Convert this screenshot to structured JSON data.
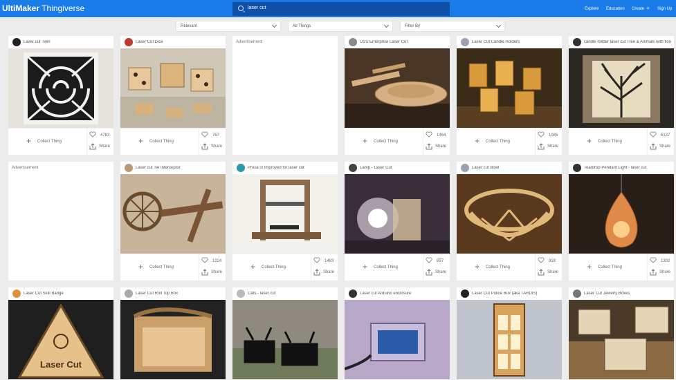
{
  "header": {
    "brand_bold": "UltiMaker",
    "brand_light": " Thingiverse",
    "search_value": "laser cut",
    "nav": [
      "Explore",
      "Education",
      "Create",
      "Sign Up"
    ]
  },
  "filters": [
    "Relevant",
    "All Things",
    "Filter By"
  ],
  "card_actions": {
    "collect": "Collect Thing",
    "share": "Share"
  },
  "advertisement_label": "Advertisement",
  "cards": [
    {
      "title": "Laser cut Twirl",
      "likes": "4783"
    },
    {
      "title": "Laser Cut Dice",
      "likes": "757"
    },
    {
      "ad": true
    },
    {
      "title": "USS Enterprise Laser Cut",
      "likes": "1464"
    },
    {
      "title": "Laser Cut Candle Holders",
      "likes": "1085"
    },
    {
      "title": "candle holder laser cut Tree & Animals with flow...",
      "likes": "5137"
    },
    {
      "ad": true
    },
    {
      "title": "Laser cut Tie Interceptor",
      "likes": "1224"
    },
    {
      "title": "Prusa i3 Improved for laser cut",
      "likes": "1483"
    },
    {
      "title": "Lamp - Laser Cut",
      "likes": "857"
    },
    {
      "title": "Laser cut Bowl",
      "likes": "918"
    },
    {
      "title": "Teardrop Pendant Light - laser cut",
      "likes": "1302"
    },
    {
      "title": "Laser Cut Skill Badge",
      "likes": ""
    },
    {
      "title": "Laser Cut Roll Top Box",
      "likes": ""
    },
    {
      "title": "Cats - laser cut",
      "likes": ""
    },
    {
      "title": "Laser cut Arduino enclosure",
      "likes": ""
    },
    {
      "title": "Laser Cut Police Box (aka TARDIS)",
      "likes": ""
    },
    {
      "title": "Laser Cut Jewelry Boxes",
      "likes": ""
    }
  ],
  "badge_text": "Laser Cut",
  "colors": {
    "brand_blue": "#1a7ce8",
    "search_bg": "#0f4fa8",
    "page_bg": "#ececec"
  }
}
